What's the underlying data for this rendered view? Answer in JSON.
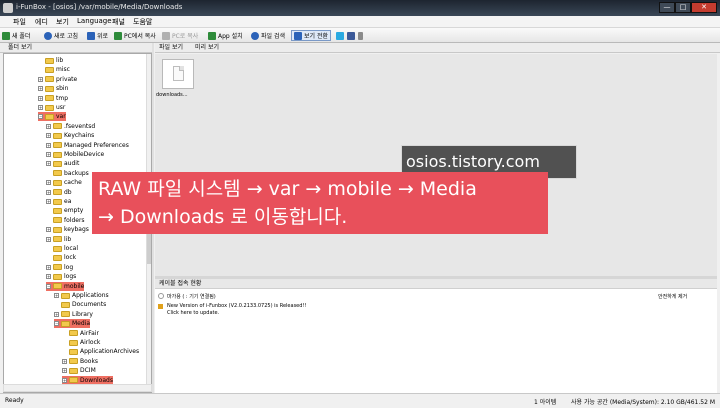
{
  "window": {
    "title": "i-FunBox - [osios] /var/mobile/Media/Downloads",
    "buttons": {
      "minimize": "—",
      "maximize": "□",
      "close": "✕"
    }
  },
  "menu": [
    "파일",
    "에디",
    "보기",
    "Language",
    "패널",
    "도움말"
  ],
  "toolbar": [
    {
      "label": "새 폴더",
      "icon": "new-folder-icon",
      "color": "#2e8b3a",
      "disabled": false
    },
    {
      "label": "새로 고침",
      "icon": "refresh-icon",
      "color": "#2b62b8",
      "disabled": false
    },
    {
      "label": "위로",
      "icon": "up-arrow-icon",
      "color": "#2b62b8",
      "disabled": false
    },
    {
      "label": "PC에서 복사",
      "icon": "copy-from-pc-icon",
      "color": "#2e8b3a",
      "disabled": false
    },
    {
      "label": "PC로 복사",
      "icon": "copy-to-pc-icon",
      "color": "#9a9a9a",
      "disabled": true
    },
    {
      "label": "App 설치",
      "icon": "app-install-icon",
      "color": "#2e8b3a",
      "disabled": false
    },
    {
      "label": "파일 검색",
      "icon": "search-icon",
      "color": "#2b62b8",
      "disabled": false
    },
    {
      "label": "보기 전환",
      "icon": "view-switch-icon",
      "color": "#2b62b8",
      "disabled": false,
      "active": true
    }
  ],
  "social": [
    {
      "icon": "twitter-icon",
      "color": "#29a9e1"
    },
    {
      "icon": "facebook-icon",
      "color": "#3b5998"
    },
    {
      "icon": "dropdown-arrow-icon",
      "color": "#555555"
    }
  ],
  "tree_header": "폴더 보기",
  "tree": [
    {
      "label": "lib",
      "indent": 0,
      "exp": ""
    },
    {
      "label": "misc",
      "indent": 0,
      "exp": ""
    },
    {
      "label": "private",
      "indent": 0,
      "exp": "+"
    },
    {
      "label": "sbin",
      "indent": 0,
      "exp": "+"
    },
    {
      "label": "tmp",
      "indent": 0,
      "exp": "+"
    },
    {
      "label": "usr",
      "indent": 0,
      "exp": "+"
    },
    {
      "label": "var",
      "indent": 0,
      "exp": "−",
      "highlight": true
    },
    {
      "label": ".fseventsd",
      "indent": 1,
      "exp": "+"
    },
    {
      "label": "Keychains",
      "indent": 1,
      "exp": "+"
    },
    {
      "label": "Managed Preferences",
      "indent": 1,
      "exp": "+"
    },
    {
      "label": "MobileDevice",
      "indent": 1,
      "exp": "+"
    },
    {
      "label": "audit",
      "indent": 1,
      "exp": "+"
    },
    {
      "label": "backups",
      "indent": 1,
      "exp": ""
    },
    {
      "label": "cache",
      "indent": 1,
      "exp": "+"
    },
    {
      "label": "db",
      "indent": 1,
      "exp": "+"
    },
    {
      "label": "ea",
      "indent": 1,
      "exp": "+"
    },
    {
      "label": "empty",
      "indent": 1,
      "exp": ""
    },
    {
      "label": "folders",
      "indent": 1,
      "exp": ""
    },
    {
      "label": "keybags",
      "indent": 1,
      "exp": "+"
    },
    {
      "label": "lib",
      "indent": 1,
      "exp": "+"
    },
    {
      "label": "local",
      "indent": 1,
      "exp": ""
    },
    {
      "label": "lock",
      "indent": 1,
      "exp": ""
    },
    {
      "label": "log",
      "indent": 1,
      "exp": "+"
    },
    {
      "label": "logs",
      "indent": 1,
      "exp": "+"
    },
    {
      "label": "mobile",
      "indent": 1,
      "exp": "−",
      "highlight": true
    },
    {
      "label": "Applications",
      "indent": 2,
      "exp": "+"
    },
    {
      "label": "Documents",
      "indent": 2,
      "exp": ""
    },
    {
      "label": "Library",
      "indent": 2,
      "exp": "+"
    },
    {
      "label": "Media",
      "indent": 2,
      "exp": "−",
      "highlight": true
    },
    {
      "label": "AirFair",
      "indent": 3,
      "exp": ""
    },
    {
      "label": "Airlock",
      "indent": 3,
      "exp": ""
    },
    {
      "label": "ApplicationArchives",
      "indent": 3,
      "exp": ""
    },
    {
      "label": "Books",
      "indent": 3,
      "exp": "+"
    },
    {
      "label": "DCIM",
      "indent": 3,
      "exp": "+"
    },
    {
      "label": "Downloads",
      "indent": 3,
      "exp": "+",
      "highlight": true
    }
  ],
  "tabs": [
    "파일 보기",
    "미리 보기"
  ],
  "files": [
    {
      "name": "downloads..."
    }
  ],
  "info": {
    "header": "케이블 접속 현황",
    "device": "마가용 ( : 기기 연결됨)",
    "update_title": "New Version of i-Funbox (V2.0.2133.0725) is Released!!",
    "update_sub": "Click here to update.",
    "safe_remove": "안전하게 제거"
  },
  "status": {
    "left": "Ready",
    "count": "1 아이템",
    "space": "사용 가능 공간 (Media/System): 2.10 GB/461.52 M"
  },
  "overlay": {
    "watermark": "osios.tistory.com",
    "line1": "RAW 파일 시스템 → var → mobile → Media",
    "line2": "→ Downloads 로 이동합니다."
  }
}
